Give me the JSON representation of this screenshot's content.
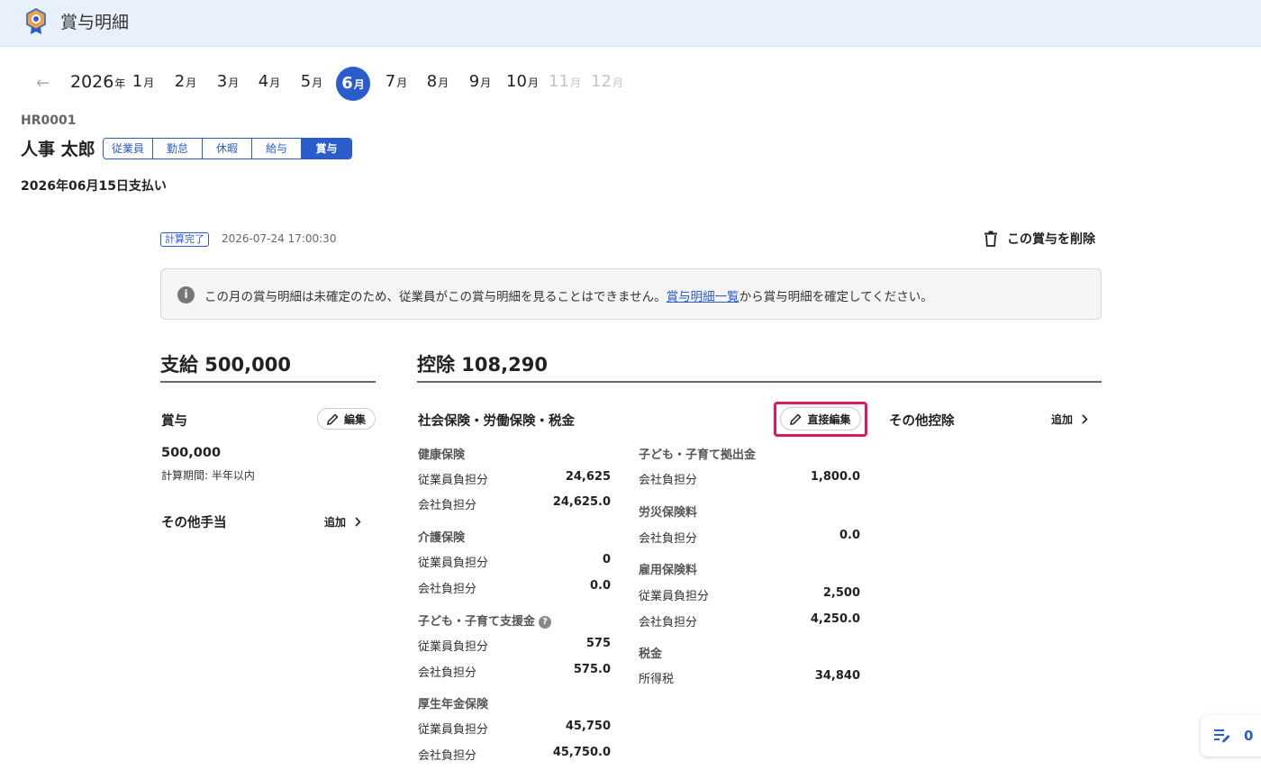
{
  "app": {
    "title": "賞与明細"
  },
  "calendar": {
    "year": "2026",
    "year_suffix": "年",
    "month_suffix": "月",
    "months": [
      "1",
      "2",
      "3",
      "4",
      "5",
      "6",
      "7",
      "8",
      "9",
      "10",
      "11",
      "12"
    ],
    "selected": "6"
  },
  "employee": {
    "id": "HR0001",
    "name": "人事 太郎",
    "tabs": [
      "従業員",
      "勤怠",
      "休暇",
      "給与",
      "賞与"
    ],
    "active_tab": "賞与",
    "pay_date": "2026年06月15日支払い"
  },
  "status": {
    "badge": "計算完了",
    "timestamp": "2026-07-24 17:00:30",
    "delete_label": "この賞与を削除"
  },
  "notice": {
    "before": "この月の賞与明細は未確定のため、従業員がこの賞与明細を見ることはできません。",
    "link": "賞与明細一覧",
    "after": "から賞与明細を確定してください。"
  },
  "payment": {
    "heading": "支給 500,000",
    "bonus_label": "賞与",
    "edit_label": "編集",
    "bonus_amount": "500,000",
    "period_note": "計算期間: 半年以内",
    "other_label": "その他手当",
    "add_label": "追加"
  },
  "deduction": {
    "heading": "控除 108,290",
    "social_label": "社会保険・労働保険・税金",
    "direct_edit_label": "直接編集",
    "other_label": "その他控除",
    "add_label": "追加",
    "health": {
      "title": "健康保険",
      "employee_label": "従業員負担分",
      "employee": "24,625",
      "company_label": "会社負担分",
      "company": "24,625.0"
    },
    "care": {
      "title": "介護保険",
      "employee_label": "従業員負担分",
      "employee": "0",
      "company_label": "会社負担分",
      "company": "0.0"
    },
    "child_support": {
      "title": "子ども・子育て支援金",
      "employee_label": "従業員負担分",
      "employee": "575",
      "company_label": "会社負担分",
      "company": "575.0"
    },
    "pension": {
      "title": "厚生年金保険",
      "employee_label": "従業員負担分",
      "employee": "45,750",
      "company_label": "会社負担分",
      "company": "45,750.0"
    },
    "child_contribution": {
      "title": "子ども・子育て拠出金",
      "company_label": "会社負担分",
      "company": "1,800.0"
    },
    "workers_comp": {
      "title": "労災保険料",
      "company_label": "会社負担分",
      "company": "0.0"
    },
    "employment": {
      "title": "雇用保険料",
      "employee_label": "従業員負担分",
      "employee": "2,500",
      "company_label": "会社負担分",
      "company": "4,250.0"
    },
    "tax": {
      "title": "税金",
      "income_label": "所得税",
      "income": "34,840"
    }
  },
  "float_counter": "0",
  "colors": {
    "accent": "#2a5ccc",
    "highlight": "#e0195f",
    "topbar": "#e8f0fb"
  }
}
